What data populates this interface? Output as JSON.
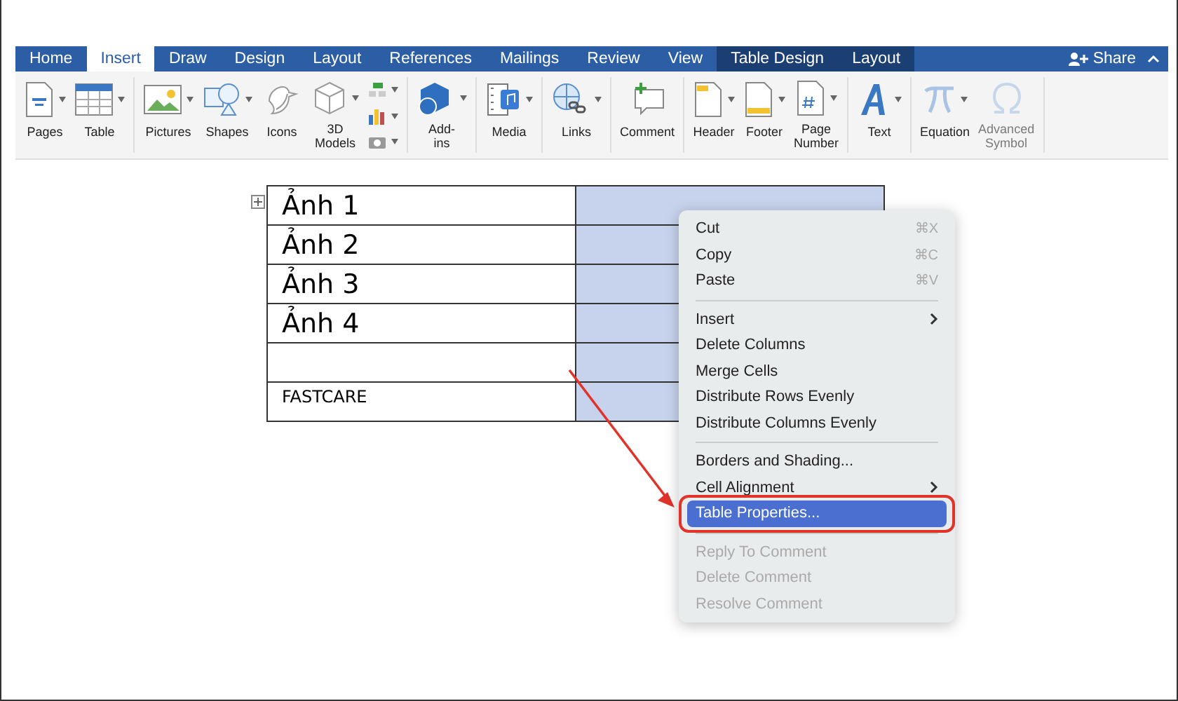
{
  "tabs": [
    {
      "label": "Home",
      "selected": false,
      "contextual": false
    },
    {
      "label": "Insert",
      "selected": true,
      "contextual": false
    },
    {
      "label": "Draw",
      "selected": false,
      "contextual": false
    },
    {
      "label": "Design",
      "selected": false,
      "contextual": false
    },
    {
      "label": "Layout",
      "selected": false,
      "contextual": false
    },
    {
      "label": "References",
      "selected": false,
      "contextual": false
    },
    {
      "label": "Mailings",
      "selected": false,
      "contextual": false
    },
    {
      "label": "Review",
      "selected": false,
      "contextual": false
    },
    {
      "label": "View",
      "selected": false,
      "contextual": false
    },
    {
      "label": "Table Design",
      "selected": false,
      "contextual": true
    },
    {
      "label": "Layout",
      "selected": false,
      "contextual": true
    }
  ],
  "share": {
    "label": "Share"
  },
  "ribbon": {
    "groups": [
      {
        "items": [
          {
            "kind": "button",
            "label": "Pages",
            "dropdown": true,
            "disabled": false
          },
          {
            "kind": "button",
            "label": "Table",
            "dropdown": true,
            "disabled": false
          }
        ]
      },
      {
        "items": [
          {
            "kind": "button",
            "label": "Pictures",
            "dropdown": true,
            "disabled": false
          },
          {
            "kind": "button",
            "label": "Shapes",
            "dropdown": true,
            "disabled": false
          },
          {
            "kind": "button",
            "label": "Icons",
            "dropdown": false,
            "disabled": false
          },
          {
            "kind": "button",
            "label": "3D Models",
            "dropdown": true,
            "disabled": false
          },
          {
            "kind": "stack"
          }
        ]
      },
      {
        "items": [
          {
            "kind": "button",
            "label": "Add-ins",
            "dropdown": true,
            "disabled": false
          }
        ]
      },
      {
        "items": [
          {
            "kind": "button",
            "label": "Media",
            "dropdown": true,
            "disabled": false
          }
        ]
      },
      {
        "items": [
          {
            "kind": "button",
            "label": "Links",
            "dropdown": true,
            "disabled": false
          }
        ]
      },
      {
        "items": [
          {
            "kind": "button",
            "label": "Comment",
            "dropdown": false,
            "disabled": false
          }
        ]
      },
      {
        "items": [
          {
            "kind": "button",
            "label": "Header",
            "dropdown": true,
            "disabled": false
          },
          {
            "kind": "button",
            "label": "Footer",
            "dropdown": true,
            "disabled": false
          },
          {
            "kind": "button",
            "label": "Page Number",
            "dropdown": true,
            "disabled": false
          }
        ]
      },
      {
        "items": [
          {
            "kind": "button",
            "label": "Text",
            "dropdown": true,
            "disabled": false
          }
        ]
      },
      {
        "items": [
          {
            "kind": "button",
            "label": "Equation",
            "dropdown": true,
            "disabled": false
          },
          {
            "kind": "button",
            "label": "Advanced Symbol",
            "dropdown": false,
            "disabled": true
          }
        ]
      }
    ]
  },
  "table": {
    "rows": [
      {
        "kind": "large",
        "cells": [
          {
            "text": "Ảnh 1",
            "selected": false
          },
          {
            "selected": true
          }
        ]
      },
      {
        "kind": "large",
        "cells": [
          {
            "text": "Ảnh 2",
            "selected": false
          },
          {
            "selected": true
          }
        ]
      },
      {
        "kind": "large",
        "cells": [
          {
            "text": "Ảnh 3",
            "selected": false
          },
          {
            "selected": true
          }
        ]
      },
      {
        "kind": "large",
        "cells": [
          {
            "text": "Ảnh 4",
            "selected": false
          },
          {
            "selected": true
          }
        ]
      },
      {
        "kind": "large",
        "cells": [
          {
            "selected": false
          },
          {
            "selected": true
          }
        ]
      },
      {
        "kind": "small",
        "cells": [
          {
            "text": "FASTCARE",
            "selected": false
          },
          {
            "selected": true
          }
        ]
      }
    ]
  },
  "context_menu": {
    "sections": [
      {
        "items": [
          {
            "label": "Cut",
            "shortcut": "⌘X",
            "submenu": false,
            "disabled": false,
            "selected": false
          },
          {
            "label": "Copy",
            "shortcut": "⌘C",
            "submenu": false,
            "disabled": false,
            "selected": false
          },
          {
            "label": "Paste",
            "shortcut": "⌘V",
            "submenu": false,
            "disabled": false,
            "selected": false
          }
        ]
      },
      {
        "items": [
          {
            "label": "Insert",
            "submenu": true,
            "disabled": false,
            "selected": false
          },
          {
            "label": "Delete Columns",
            "submenu": false,
            "disabled": false,
            "selected": false
          },
          {
            "label": "Merge Cells",
            "submenu": false,
            "disabled": false,
            "selected": false
          },
          {
            "label": "Distribute Rows Evenly",
            "submenu": false,
            "disabled": false,
            "selected": false
          },
          {
            "label": "Distribute Columns Evenly",
            "submenu": false,
            "disabled": false,
            "selected": false
          }
        ]
      },
      {
        "items": [
          {
            "label": "Borders and Shading...",
            "submenu": false,
            "disabled": false,
            "selected": false
          },
          {
            "label": "Cell Alignment",
            "submenu": true,
            "disabled": false,
            "selected": false
          },
          {
            "label": "Table Properties...",
            "submenu": false,
            "disabled": false,
            "selected": true
          }
        ]
      },
      {
        "items": [
          {
            "label": "Reply To Comment",
            "submenu": false,
            "disabled": true,
            "selected": false
          },
          {
            "label": "Delete Comment",
            "submenu": false,
            "disabled": true,
            "selected": false
          },
          {
            "label": "Resolve Comment",
            "submenu": false,
            "disabled": true,
            "selected": false
          }
        ]
      }
    ]
  }
}
